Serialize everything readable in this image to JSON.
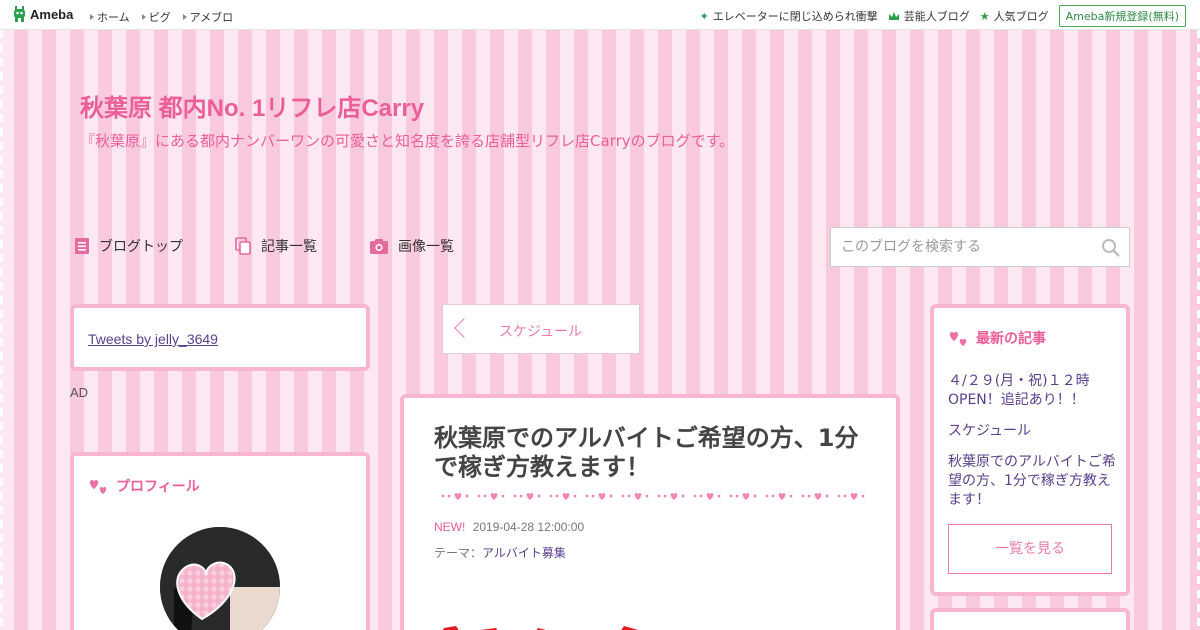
{
  "topbar": {
    "logo": "Ameba",
    "nav": [
      "ホーム",
      "ピグ",
      "アメブロ"
    ],
    "right": [
      {
        "icon": "sparkle-icon",
        "label": "エレベーターに閉じ込められ衝撃"
      },
      {
        "icon": "crown-icon",
        "label": "芸能人ブログ"
      },
      {
        "icon": "star-icon",
        "label": "人気ブログ"
      }
    ],
    "register": "Ameba新規登録(無料)"
  },
  "header": {
    "title": "秋葉原 都内No. 1リフレ店Carry",
    "description": "『秋葉原』にある都内ナンバーワンの可愛さと知名度を誇る店舗型リフレ店Carryのブログです。"
  },
  "nav": {
    "items": [
      "ブログトップ",
      "記事一覧",
      "画像一覧"
    ],
    "search_placeholder": "このブログを検索する"
  },
  "sidebar_left": {
    "tweets_link": "Tweets by jelly_3649",
    "ad_label": "AD",
    "profile_heading": "プロフィール"
  },
  "main": {
    "prev_article": "スケジュール",
    "article": {
      "title": "秋葉原でのアルバイトご希望の方、1分で稼ぎ方教えます！",
      "new_badge": "NEW!",
      "date": "2019-04-28 12:00:00",
      "theme_label": "テーマ：",
      "theme": "アルバイト募集"
    }
  },
  "sidebar_right": {
    "heading": "最新の記事",
    "items": [
      "４/２９(月・祝)１２時OPEN！追記あり！！",
      "スケジュール",
      "秋葉原でのアルバイトご希望の方、1分で稼ぎ方教えます！"
    ],
    "more": "一覧を見る"
  },
  "colors": {
    "accent_pink": "#ec5e9a",
    "link_purple": "#5a3f8c",
    "box_border": "#f7b5cf",
    "ameba_green": "#2aa04a"
  }
}
